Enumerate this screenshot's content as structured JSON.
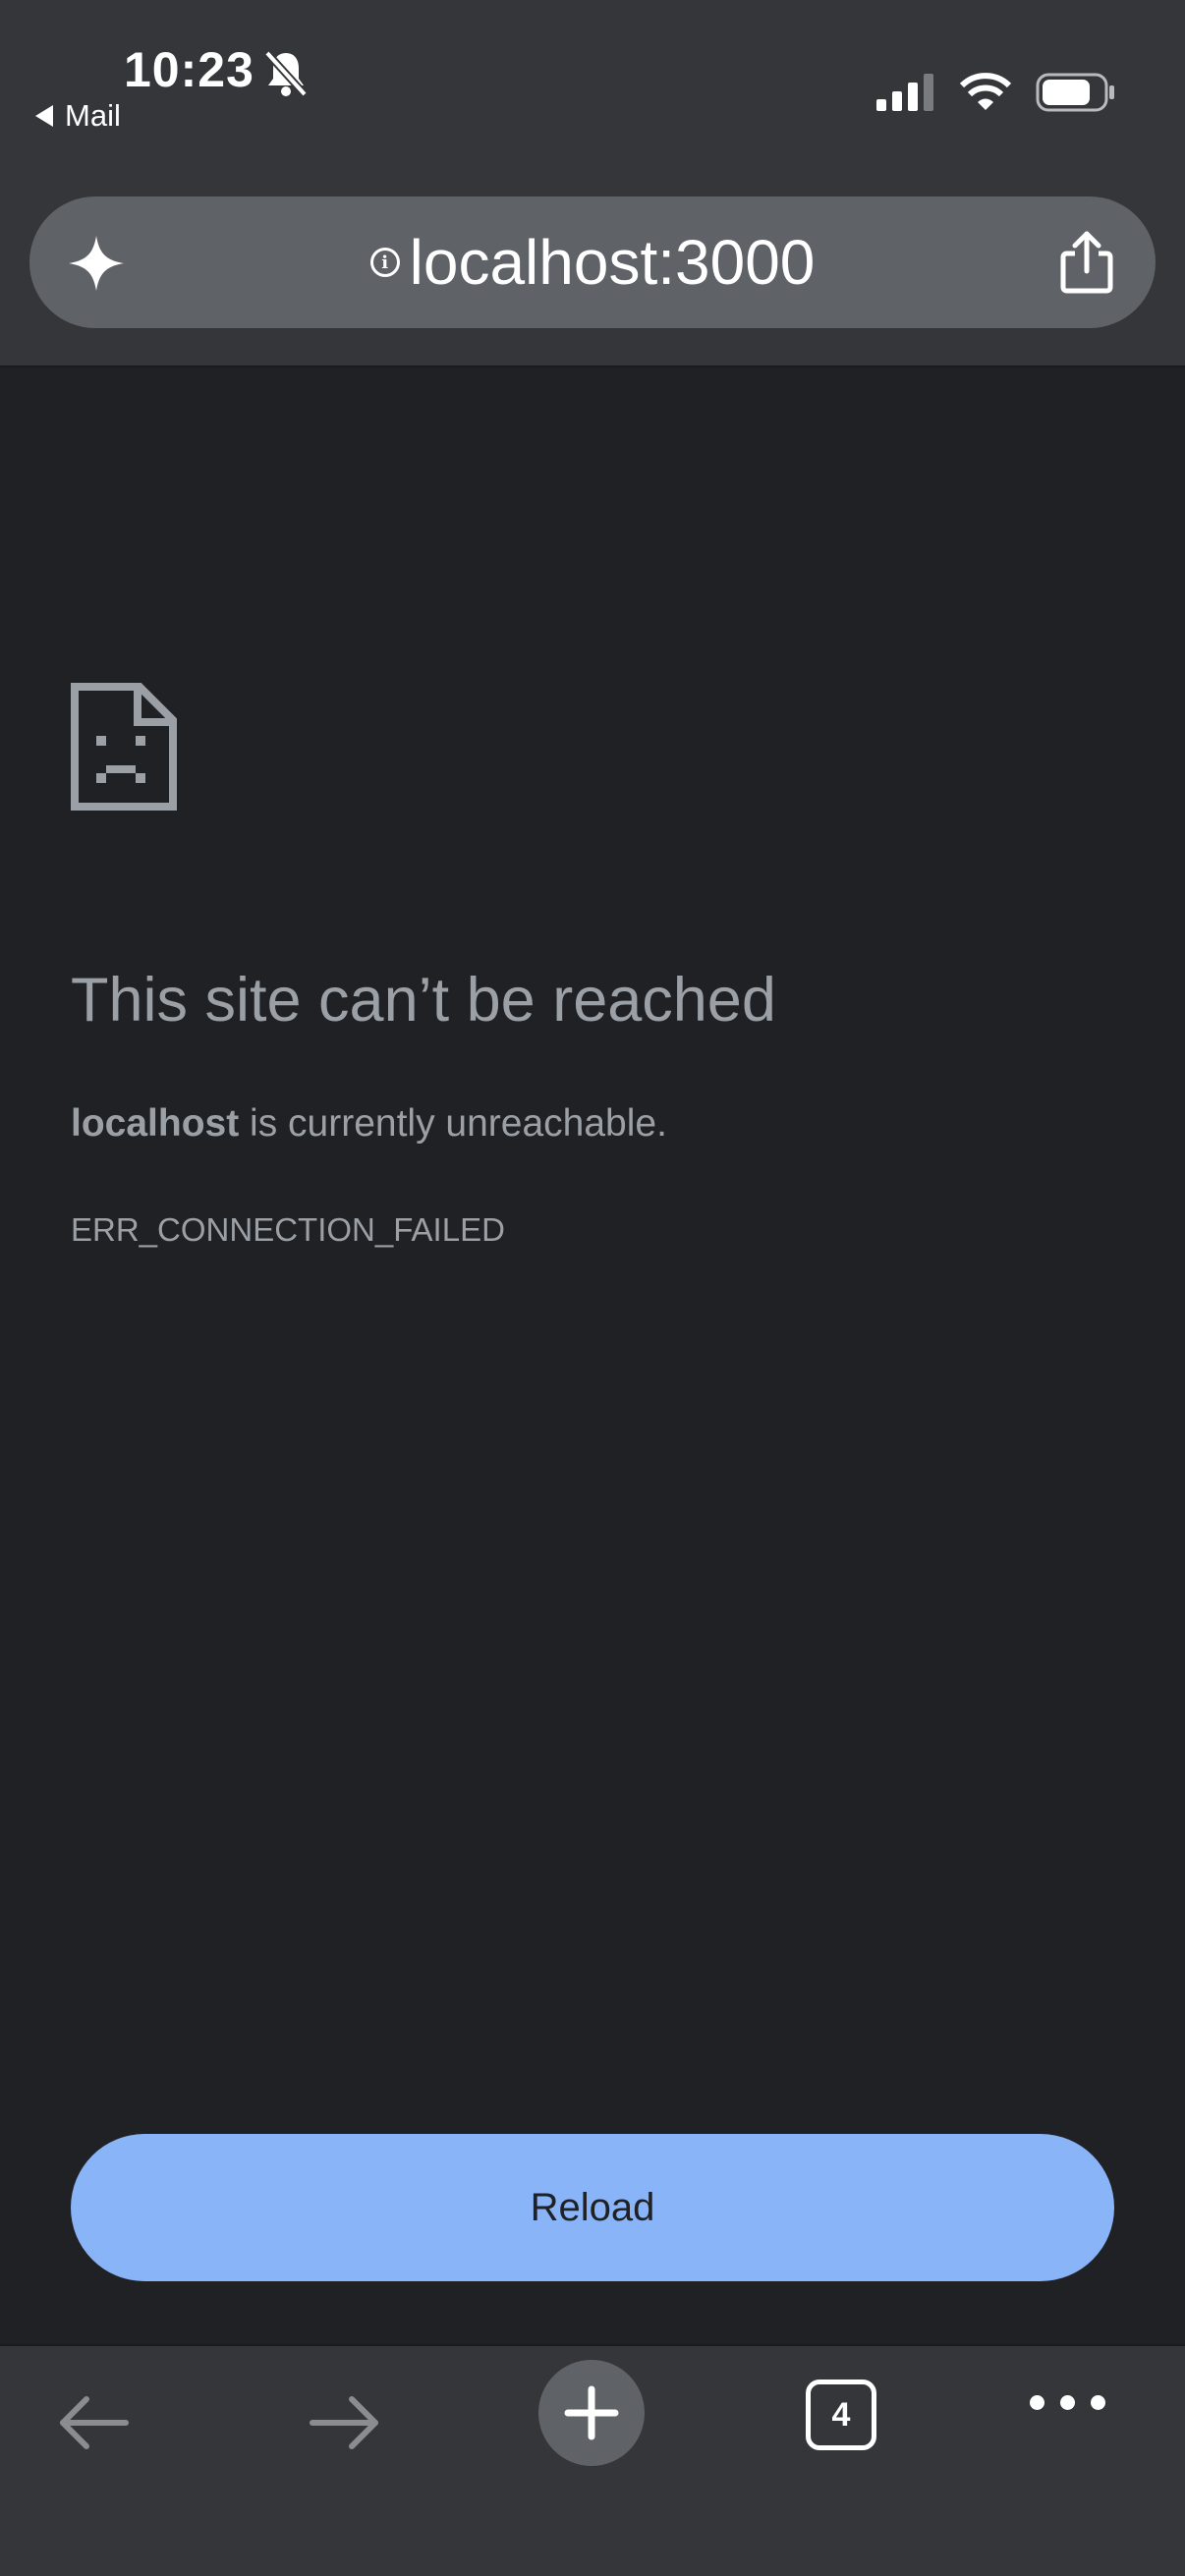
{
  "status_bar": {
    "time": "10:23",
    "back_label": "Mail",
    "icons": [
      "bell-slash-icon",
      "cellular-signal-icon",
      "wifi-icon",
      "battery-icon"
    ]
  },
  "omnibox": {
    "url": "localhost:3000",
    "icons": [
      "sparkle-icon",
      "info-icon",
      "share-icon"
    ]
  },
  "error_page": {
    "title": "This site can’t be reached",
    "host": "localhost",
    "message": " is currently unreachable.",
    "error_code": "ERR_CONNECTION_FAILED",
    "reload_label": "Reload"
  },
  "toolbar": {
    "tab_count": "4",
    "icons": [
      "back-arrow-icon",
      "forward-arrow-icon",
      "plus-icon",
      "tab-switcher-icon",
      "more-icon"
    ]
  },
  "colors": {
    "top_bar": "#35363a",
    "page_background": "#202124",
    "omnibox": "#5f6368",
    "text_secondary": "#9aa0a6",
    "reload_button": "#8ab4f8"
  }
}
